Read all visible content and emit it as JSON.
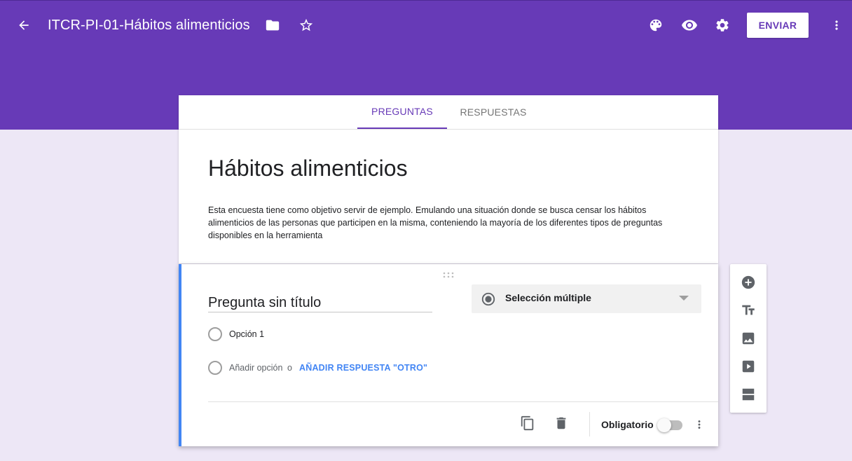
{
  "header": {
    "title": "ITCR-PI-01-Hábitos alimenticios",
    "send_label": "ENVIAR",
    "icons": [
      "back-arrow-icon",
      "folder-icon",
      "star-outline-icon",
      "palette-icon",
      "preview-eye-icon",
      "settings-gear-icon",
      "more-vert-icon"
    ],
    "brand_color": "#673ab7"
  },
  "tabs": {
    "questions": "PREGUNTAS",
    "responses": "RESPUESTAS",
    "active": "PREGUNTAS"
  },
  "form": {
    "title": "Hábitos alimenticios",
    "description": "Esta encuesta tiene como objetivo servir de ejemplo. Emulando una situación donde se busca censar los hábitos alimenticios de las personas que participen en la misma, conteniendo la mayoría de los diferentes tipos de preguntas disponibles en la herramienta"
  },
  "question": {
    "title": "Pregunta sin título",
    "type": "Selección múltiple",
    "option1": "Opción 1",
    "add_option": "Añadir opción",
    "or_text": "o",
    "add_other": "AÑADIR RESPUESTA \"OTRO\"",
    "required_label": "Obligatorio",
    "required": false,
    "accent_color": "#4285f4"
  },
  "side_toolbar": {
    "icons": [
      "add-question-icon",
      "add-title-text-icon",
      "add-image-icon",
      "add-video-icon",
      "add-section-icon"
    ]
  }
}
